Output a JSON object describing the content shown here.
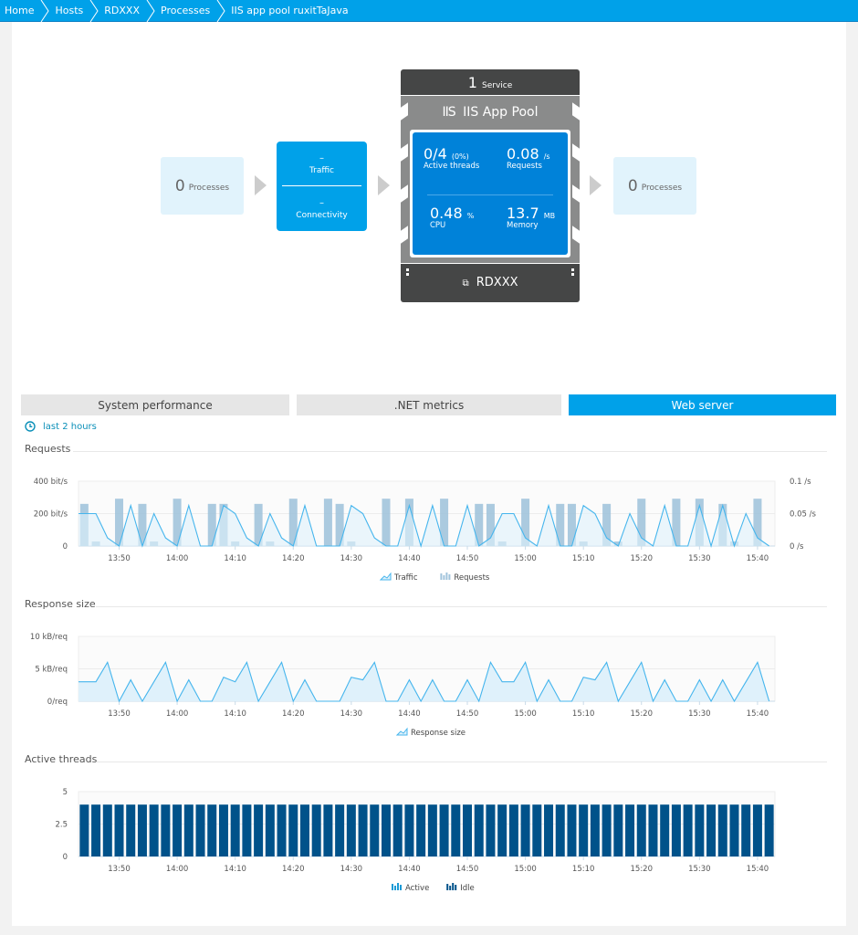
{
  "breadcrumb": [
    "Home",
    "Hosts",
    "RDXXX",
    "Processes",
    "IIS app pool ruxitTaJava"
  ],
  "flow": {
    "left_processes": {
      "count": "0",
      "label": "Processes"
    },
    "service_box": {
      "traffic_value": "–",
      "traffic_label": "Traffic",
      "connectivity_value": "–",
      "connectivity_label": "Connectivity"
    },
    "right_processes": {
      "count": "0",
      "label": "Processes"
    }
  },
  "process_group": {
    "services_count": "1",
    "services_label": "Service",
    "icon_text": "IIS",
    "title": "IIS App Pool",
    "metrics": {
      "active_threads": {
        "value": "0/4",
        "unit": "(0%)",
        "label": "Active threads"
      },
      "requests": {
        "value": "0.08",
        "unit": "/s",
        "label": "Requests"
      },
      "cpu": {
        "value": "0.48",
        "unit": "%",
        "label": "CPU"
      },
      "memory": {
        "value": "13.7",
        "unit": "MB",
        "label": "Memory"
      }
    },
    "host_label": "RDXXX"
  },
  "tabs": [
    {
      "label": "System performance",
      "active": false
    },
    {
      "label": ".NET metrics",
      "active": false
    },
    {
      "label": "Web server",
      "active": true
    }
  ],
  "timeframe": "last 2 hours",
  "colors": {
    "accent": "#00a1e9",
    "traffic_line": "#45b5ed",
    "traffic_fill": "#dff1fb",
    "requests_bar": "#a2c4dc",
    "threads_bar": "#00528a"
  },
  "chart_data": [
    {
      "type": "bar",
      "title": "Requests",
      "x_ticks": [
        "13:50",
        "14:00",
        "14:10",
        "14:20",
        "14:30",
        "14:40",
        "14:50",
        "15:00",
        "15:10",
        "15:20",
        "15:30",
        "15:40"
      ],
      "x_start": "13:43",
      "interval_minutes": 2,
      "y_left_ticks": [
        "400 bit/s",
        "200 bit/s",
        "0"
      ],
      "y_left_range": [
        0,
        400
      ],
      "y_right_ticks": [
        "0.1 /s",
        "0.05 /s",
        "0 /s"
      ],
      "y_right_range": [
        0,
        0.1
      ],
      "series": [
        {
          "name": "Traffic",
          "type": "area",
          "axis": "left",
          "unit": "bit/s",
          "values": [
            200,
            200,
            50,
            0,
            250,
            0,
            200,
            50,
            0,
            250,
            0,
            0,
            250,
            200,
            50,
            0,
            200,
            50,
            0,
            250,
            0,
            0,
            0,
            250,
            200,
            50,
            0,
            0,
            250,
            0,
            250,
            0,
            0,
            250,
            0,
            50,
            200,
            200,
            50,
            0,
            250,
            0,
            0,
            250,
            200,
            50,
            0,
            200,
            50,
            0,
            250,
            0,
            0,
            250,
            0,
            250,
            0,
            200,
            50,
            0
          ]
        },
        {
          "name": "Requests",
          "type": "bar",
          "axis": "right",
          "unit": "/s",
          "values": [
            0.065,
            0.007,
            0,
            0.073,
            0,
            0.065,
            0.007,
            0,
            0.073,
            0,
            0,
            0.065,
            0.065,
            0.007,
            0,
            0.065,
            0.007,
            0,
            0.073,
            0,
            0,
            0.073,
            0.065,
            0.007,
            0,
            0,
            0.073,
            0,
            0.073,
            0,
            0,
            0.073,
            0,
            0,
            0.065,
            0.065,
            0.007,
            0,
            0.073,
            0,
            0,
            0.065,
            0.065,
            0.007,
            0,
            0.065,
            0.007,
            0,
            0.073,
            0,
            0,
            0.073,
            0,
            0.073,
            0,
            0.065,
            0.007,
            0,
            0.073,
            0
          ]
        }
      ],
      "legend": [
        "Traffic",
        "Requests"
      ],
      "legend_position": "bottom-center"
    },
    {
      "type": "area",
      "title": "Response size",
      "x_ticks": [
        "13:50",
        "14:00",
        "14:10",
        "14:20",
        "14:30",
        "14:40",
        "14:50",
        "15:00",
        "15:10",
        "15:20",
        "15:30",
        "15:40"
      ],
      "x_start": "13:43",
      "interval_minutes": 2,
      "y_ticks": [
        "10 kB/req",
        "5 kB/req",
        "0/req"
      ],
      "y_range": [
        0,
        10
      ],
      "series": [
        {
          "name": "Response size",
          "unit": "kB/req",
          "values": [
            3,
            3,
            6,
            0,
            3.3,
            0,
            3,
            6,
            0,
            3.3,
            0,
            0,
            3.7,
            3,
            6,
            0,
            3,
            6,
            0,
            3.3,
            0,
            0,
            0,
            3.7,
            3.3,
            6,
            0,
            0,
            3.3,
            0,
            3.3,
            0,
            0,
            3.3,
            0,
            6,
            3,
            3,
            6,
            0,
            3.3,
            0,
            0,
            3.7,
            3.3,
            6,
            0,
            3,
            6,
            0,
            3.3,
            0,
            0,
            3.3,
            0,
            3.3,
            0,
            3,
            6,
            0,
            3.3,
            0
          ]
        }
      ],
      "legend": [
        "Response size"
      ],
      "legend_position": "bottom-center"
    },
    {
      "type": "bar",
      "title": "Active threads",
      "x_ticks": [
        "13:50",
        "14:00",
        "14:10",
        "14:20",
        "14:30",
        "14:40",
        "14:50",
        "15:00",
        "15:10",
        "15:20",
        "15:30",
        "15:40"
      ],
      "x_start": "13:43",
      "interval_minutes": 2,
      "y_ticks": [
        "5",
        "2.5",
        "0"
      ],
      "y_range": [
        0,
        5
      ],
      "series": [
        {
          "name": "Active",
          "values_constant": 0,
          "count": 60
        },
        {
          "name": "Idle",
          "values_constant": 4,
          "count": 60
        }
      ],
      "legend": [
        "Active",
        "Idle"
      ],
      "legend_position": "bottom-center"
    }
  ]
}
